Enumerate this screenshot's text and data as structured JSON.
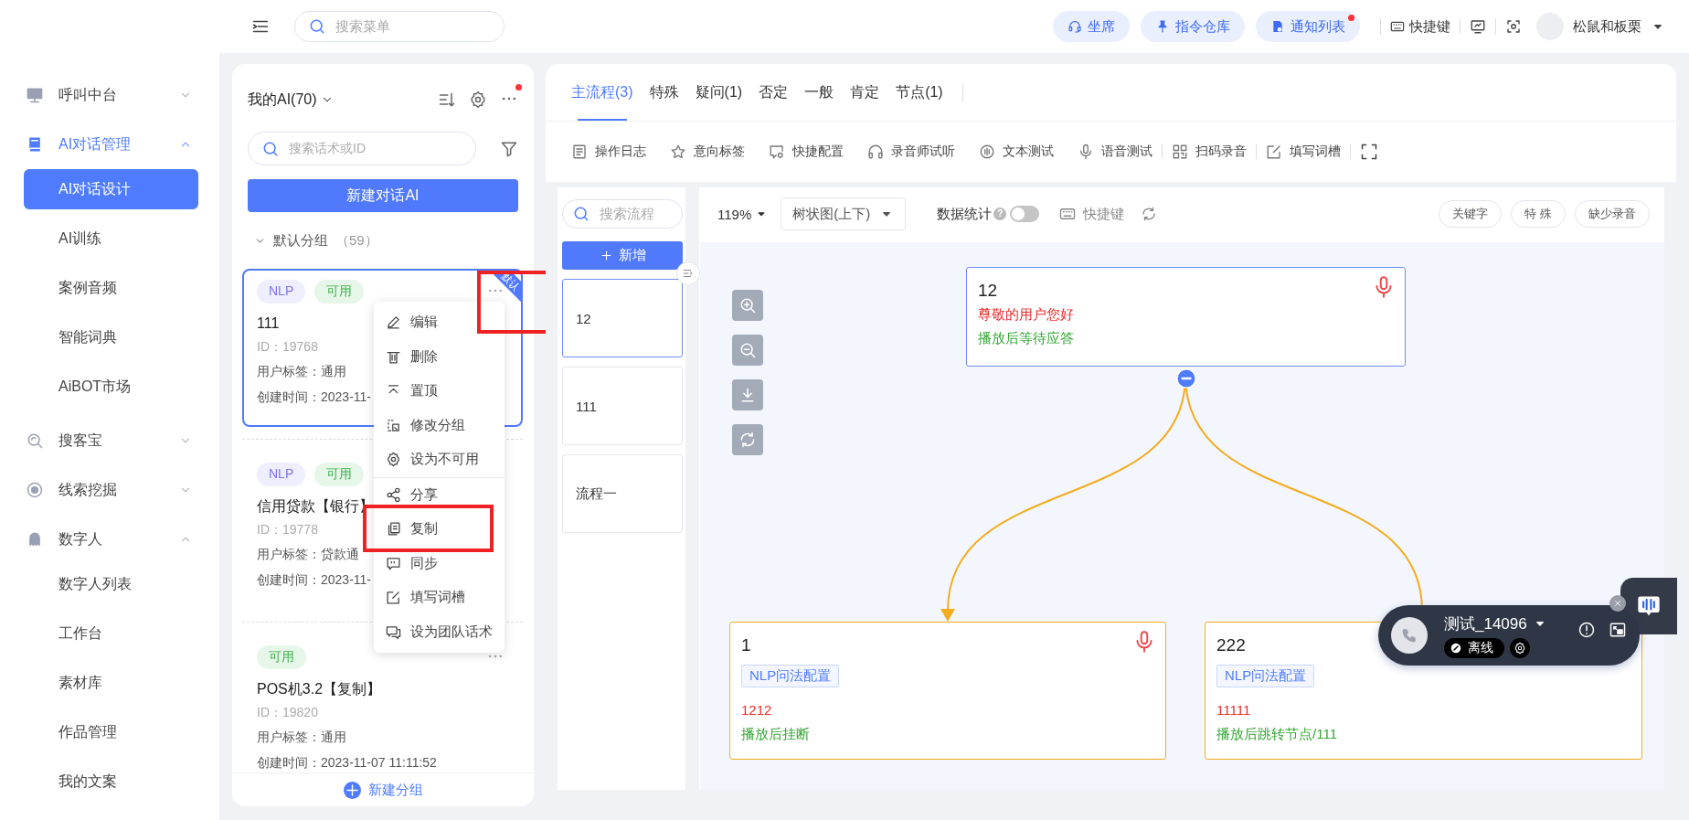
{
  "sidebar": {
    "groups": [
      {
        "label": "呼叫中台",
        "active": false,
        "expanded": false
      },
      {
        "label": "AI对话管理",
        "active": true,
        "expanded": true,
        "children": [
          {
            "label": "AI对话设计",
            "selected": true
          },
          {
            "label": "AI训练",
            "selected": false
          },
          {
            "label": "案例音频",
            "selected": false
          },
          {
            "label": "智能词典",
            "selected": false
          },
          {
            "label": "AiBOT市场",
            "selected": false
          }
        ]
      },
      {
        "label": "搜客宝",
        "active": false,
        "expanded": false
      },
      {
        "label": "线索挖掘",
        "active": false,
        "expanded": false
      },
      {
        "label": "数字人",
        "active": false,
        "expanded": true,
        "children": [
          {
            "label": "数字人列表",
            "selected": false
          },
          {
            "label": "工作台",
            "selected": false
          },
          {
            "label": "素材库",
            "selected": false
          },
          {
            "label": "作品管理",
            "selected": false
          },
          {
            "label": "我的文案",
            "selected": false
          }
        ]
      }
    ]
  },
  "top_bar": {
    "search": {
      "placeholder": "搜索菜单"
    },
    "buttons": [
      {
        "label": "坐席",
        "unread": false
      },
      {
        "label": "指令仓库",
        "unread": false
      },
      {
        "label": "通知列表",
        "unread": true
      }
    ],
    "shortcut": "快捷键",
    "user": "松鼠和板栗"
  },
  "ai_list": {
    "title": "我的AI(70)",
    "unread": true,
    "search": {
      "placeholder": "搜索话术或ID"
    },
    "new_button": "新建对话AI",
    "group": {
      "label": "默认分组",
      "count": "（59）",
      "expanded": true
    },
    "cards": [
      {
        "tags": [
          {
            "label": "NLP",
            "kind": "nlp"
          },
          {
            "label": "可用",
            "kind": "available"
          }
        ],
        "name": "111",
        "id": "ID：19768",
        "user_tag": "用户标签：通用",
        "created": "创建时间：2023-11-",
        "selected": true,
        "ribbon": "默认",
        "menu_open": true
      },
      {
        "tags": [
          {
            "label": "NLP",
            "kind": "nlp"
          },
          {
            "label": "可用",
            "kind": "available"
          }
        ],
        "name": "信用贷款【银行】",
        "id": "ID：19778",
        "user_tag": "用户标签：贷款通",
        "created": "创建时间：2023-11-",
        "selected": false,
        "menu_open": false
      },
      {
        "tags": [
          {
            "label": "可用",
            "kind": "available"
          }
        ],
        "name": "POS机3.2【复制】",
        "id": "ID：19820",
        "user_tag": "用户标签：通用",
        "created": "创建时间：2023-11-07 11:11:52",
        "selected": false,
        "menu_open": false
      }
    ],
    "context_menu": [
      [
        {
          "label": "编辑"
        },
        {
          "label": "删除"
        },
        {
          "label": "置顶"
        },
        {
          "label": "修改分组"
        },
        {
          "label": "设为不可用"
        }
      ],
      [
        {
          "label": "分享"
        },
        {
          "label": "复制"
        },
        {
          "label": "同步"
        },
        {
          "label": "填写词槽"
        },
        {
          "label": "设为团队话术"
        }
      ]
    ],
    "annotations": [
      {
        "kind": "highlight"
      },
      {
        "kind": "highlight"
      }
    ],
    "footer_button": "新建分组"
  },
  "editor": {
    "tabs": [
      {
        "label": "主流程(3)",
        "selected": true
      },
      {
        "label": "特殊",
        "selected": false
      },
      {
        "label": "疑问(1)",
        "selected": false
      },
      {
        "label": "否定",
        "selected": false
      },
      {
        "label": "一般",
        "selected": false
      },
      {
        "label": "肯定",
        "selected": false
      },
      {
        "label": "节点(1)",
        "selected": false
      }
    ],
    "toolbar": [
      "操作日志",
      "意向标签",
      "快捷配置",
      "录音师试听",
      "文本测试",
      "语音测试",
      "扫码录音",
      "填写词槽"
    ],
    "flows": {
      "search": {
        "placeholder": "搜索流程"
      },
      "add_button": "新增",
      "items": [
        {
          "label": "12",
          "selected": true
        },
        {
          "label": "111",
          "selected": false
        },
        {
          "label": "流程一",
          "selected": false
        }
      ]
    },
    "canvas": {
      "zoom": "119%",
      "layout": "树状图(上下)",
      "stats_label": "数据统计",
      "help_mark": "?",
      "stats_on": false,
      "shortcut": "快捷键",
      "filters": [
        "关键字",
        "特 殊",
        "缺少录音"
      ],
      "nodes": [
        {
          "title": "12",
          "has_audio": true,
          "lines": [
            {
              "text": "尊敬的用户您好",
              "kind": "speech"
            },
            {
              "text": "播放后等待应答",
              "kind": "action"
            }
          ]
        },
        {
          "title": "1",
          "has_audio": true,
          "intent": "NLP问法配置",
          "lines": [
            {
              "text": "1212",
              "kind": "speech"
            },
            {
              "text": "播放后挂断",
              "kind": "action"
            }
          ]
        },
        {
          "title": "222",
          "intent": "NLP问法配置",
          "lines": [
            {
              "text": "11111",
              "kind": "speech"
            },
            {
              "text": "播放后跳转节点/111",
              "kind": "action"
            }
          ]
        }
      ]
    }
  },
  "call_widget": {
    "name": "测试_14096",
    "status": "离线"
  }
}
